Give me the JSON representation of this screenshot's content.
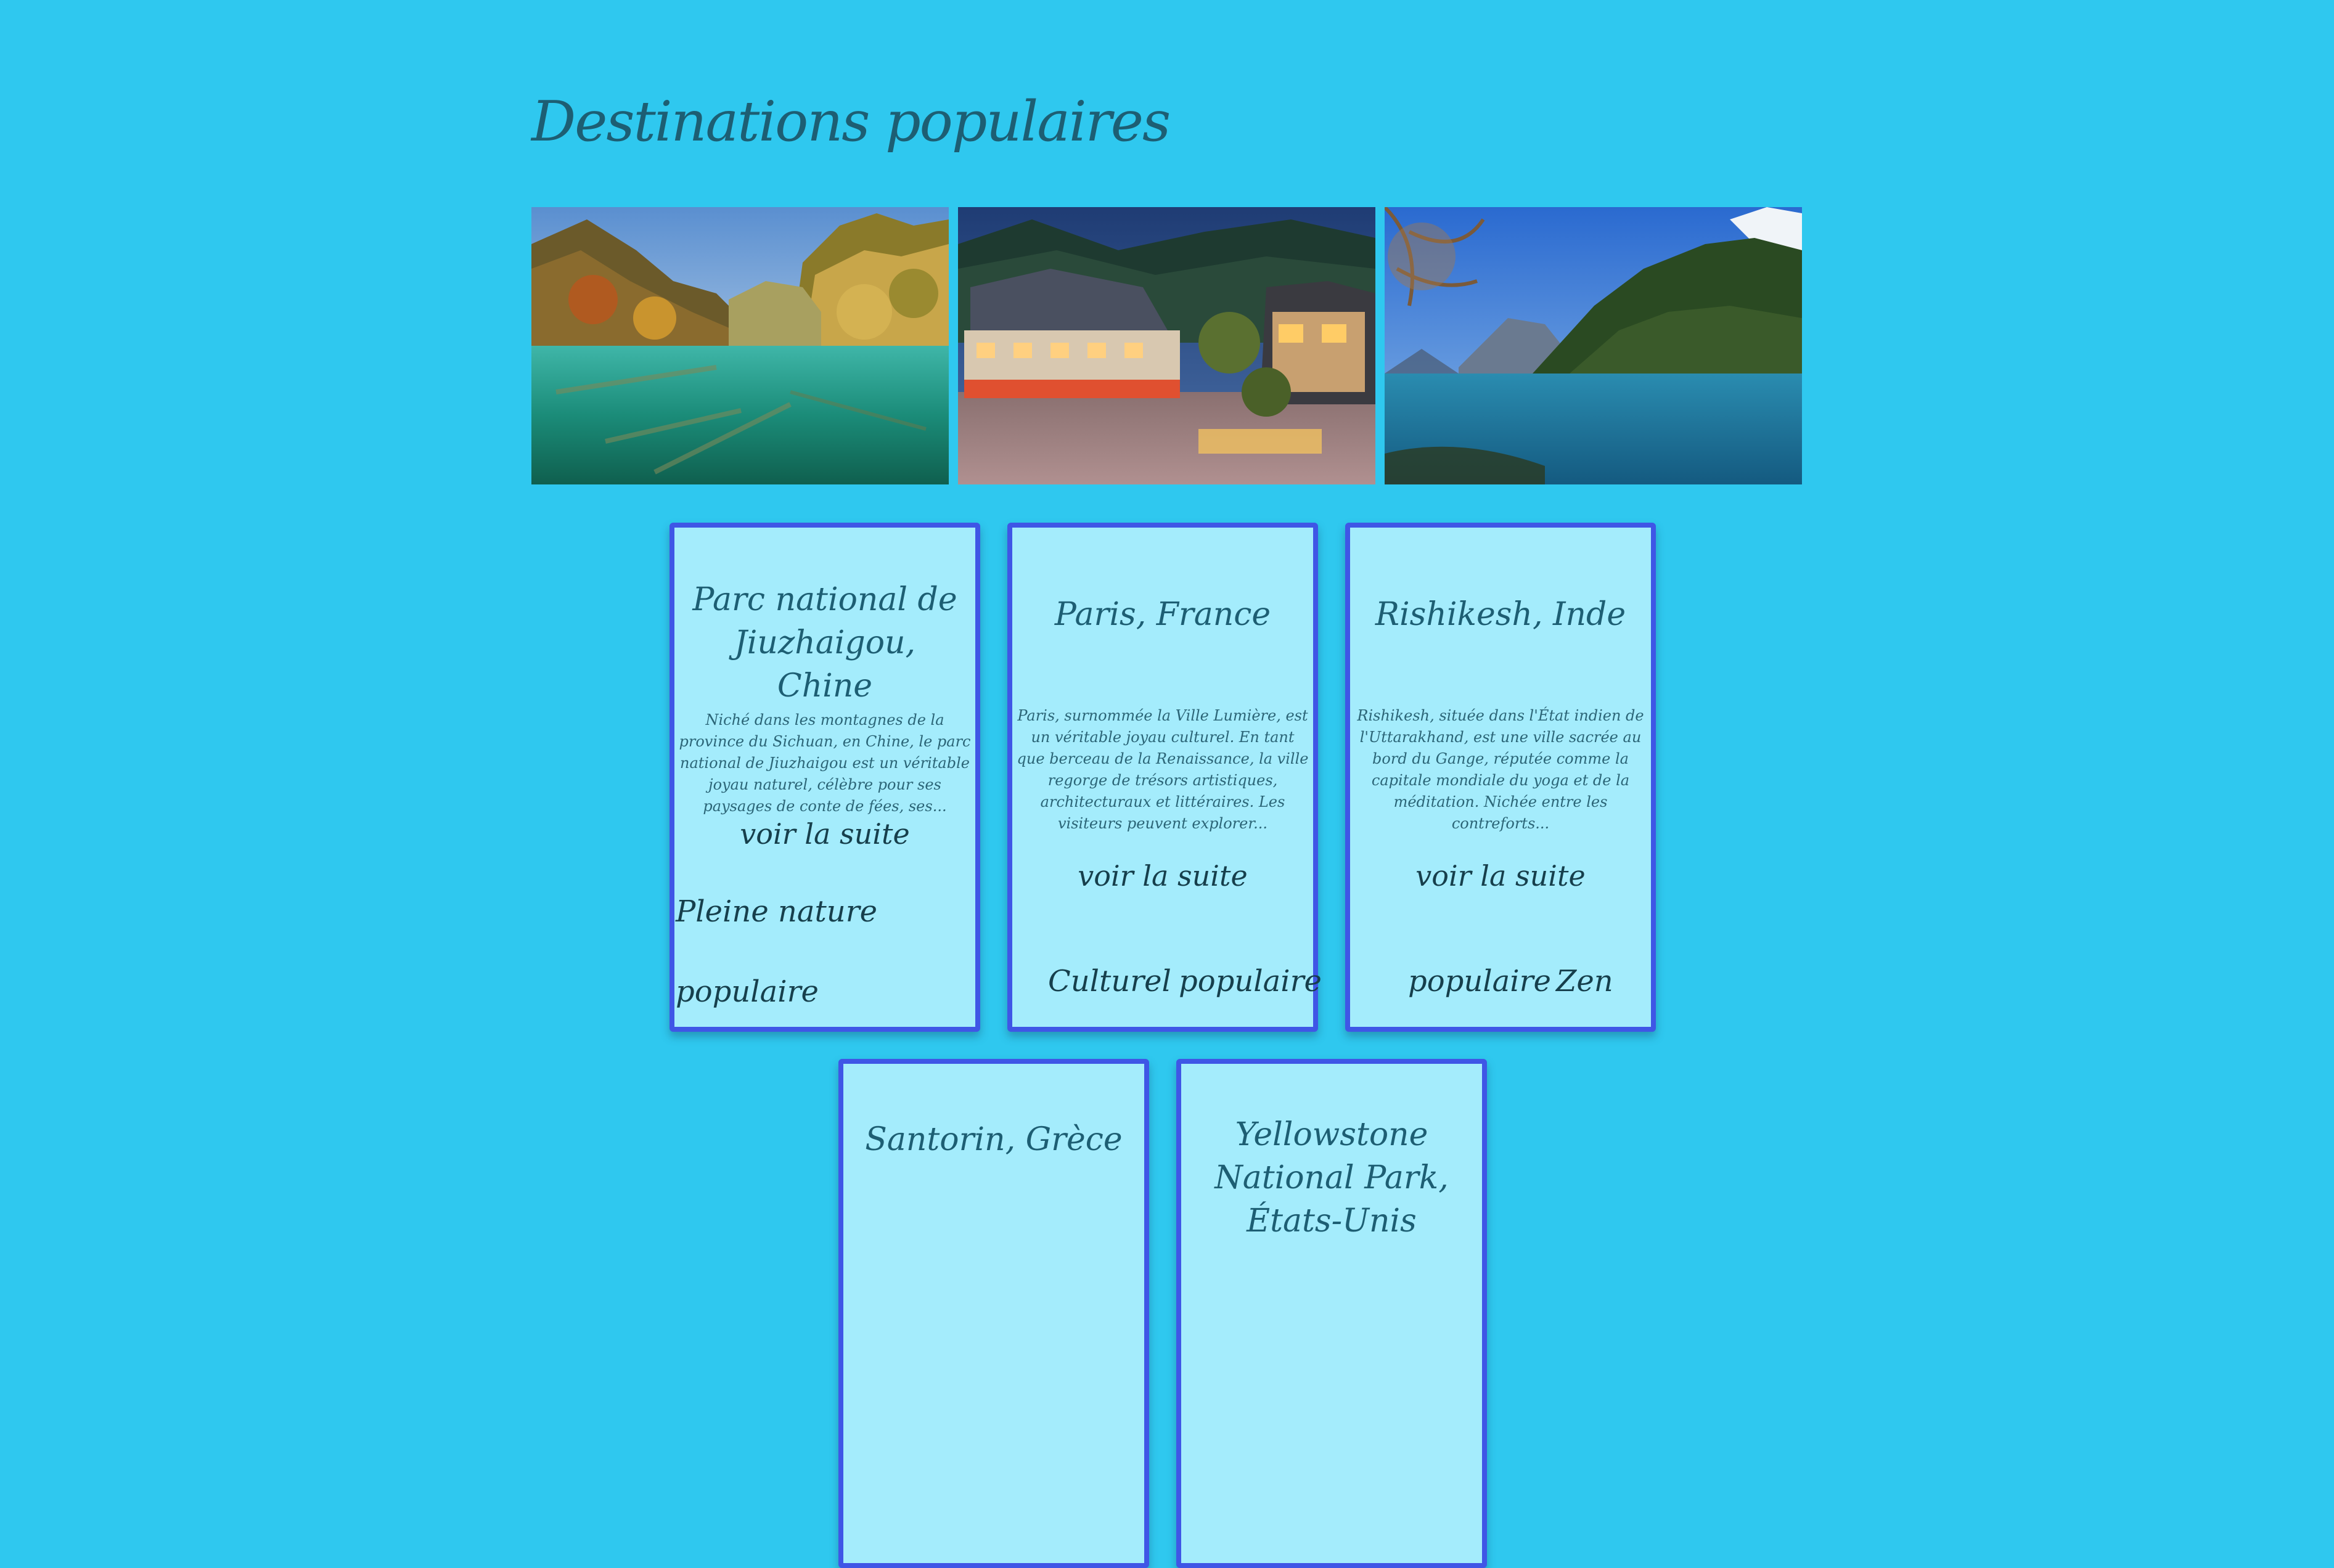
{
  "page": {
    "title": "Destinations populaires"
  },
  "cards": [
    {
      "title": "Parc national de Jiuzhaigou, Chine",
      "description": "Niché dans les montagnes de la province du Sichuan, en Chine, le parc national de Jiuzhaigou est un véritable joyau naturel, célèbre pour ses paysages de conte de fées, ses...",
      "link": "voir la suite",
      "tags": [
        "Pleine nature",
        "populaire"
      ]
    },
    {
      "title": "Paris, France",
      "description": "Paris, surnommée la Ville Lumière, est un véritable joyau culturel. En tant que berceau de la Renaissance, la ville regorge de trésors artistiques, architecturaux et littéraires. Les visiteurs peuvent explorer...",
      "link": "voir la suite",
      "tags": [
        "Culturel",
        "populaire"
      ]
    },
    {
      "title": "Rishikesh, Inde",
      "description": "Rishikesh, située dans l'État indien de l'Uttarakhand, est une ville sacrée au bord du Gange, réputée comme la capitale mondiale du yoga et de la méditation. Nichée entre les contreforts...",
      "link": "voir la suite",
      "tags": [
        "populaire",
        "Zen"
      ]
    },
    {
      "title": "Santorin, Grèce"
    },
    {
      "title": "Yellowstone National Park, États-Unis"
    }
  ]
}
